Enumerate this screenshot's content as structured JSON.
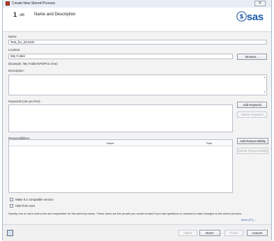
{
  "window": {
    "title": "Create New Stored Process",
    "close_glyph": "✕"
  },
  "header": {
    "step_number": "1",
    "step_of": "of6",
    "step_title": "Name and Description",
    "logo_text": "ⓢsas"
  },
  "form": {
    "name_label": "Name:",
    "name_value": "Test_for_SCSUG",
    "location_label": "Location:",
    "location_value": "/My Folder",
    "browse_label": "Browse...",
    "location_example": "(Example: /My Folder/SPs/Proc One)",
    "description_label": "Description:",
    "keywords_label": "Keywords (one per line):",
    "add_keyword_label": "Add Keyword",
    "delete_keyword_label": "Delete Keyword",
    "responsibilities_label": "Responsibilities:",
    "resp_name_header": "Name",
    "resp_role_header": "Role",
    "add_responsibility_label": "Add Responsibility",
    "delete_responsibility_label": "Delete Responsibility",
    "make92_label": "Make 9.2 compatible version",
    "hide_label": "Hide from user"
  },
  "hint": {
    "text": "Specify one or more users who are responsible for this stored process. These users are the people you would contact if you had questions or needed to make changes to the stored process.",
    "more_label": "More (F1)..."
  },
  "footer": {
    "back_label": "<Back",
    "next_label": "Next>",
    "finish_label": "Finish",
    "cancel_label": "Cancel"
  },
  "icons": {
    "app_icon": "stored-process-icon",
    "help_icon": "help-book-icon"
  },
  "colors": {
    "brand": "#1f5aa6"
  }
}
